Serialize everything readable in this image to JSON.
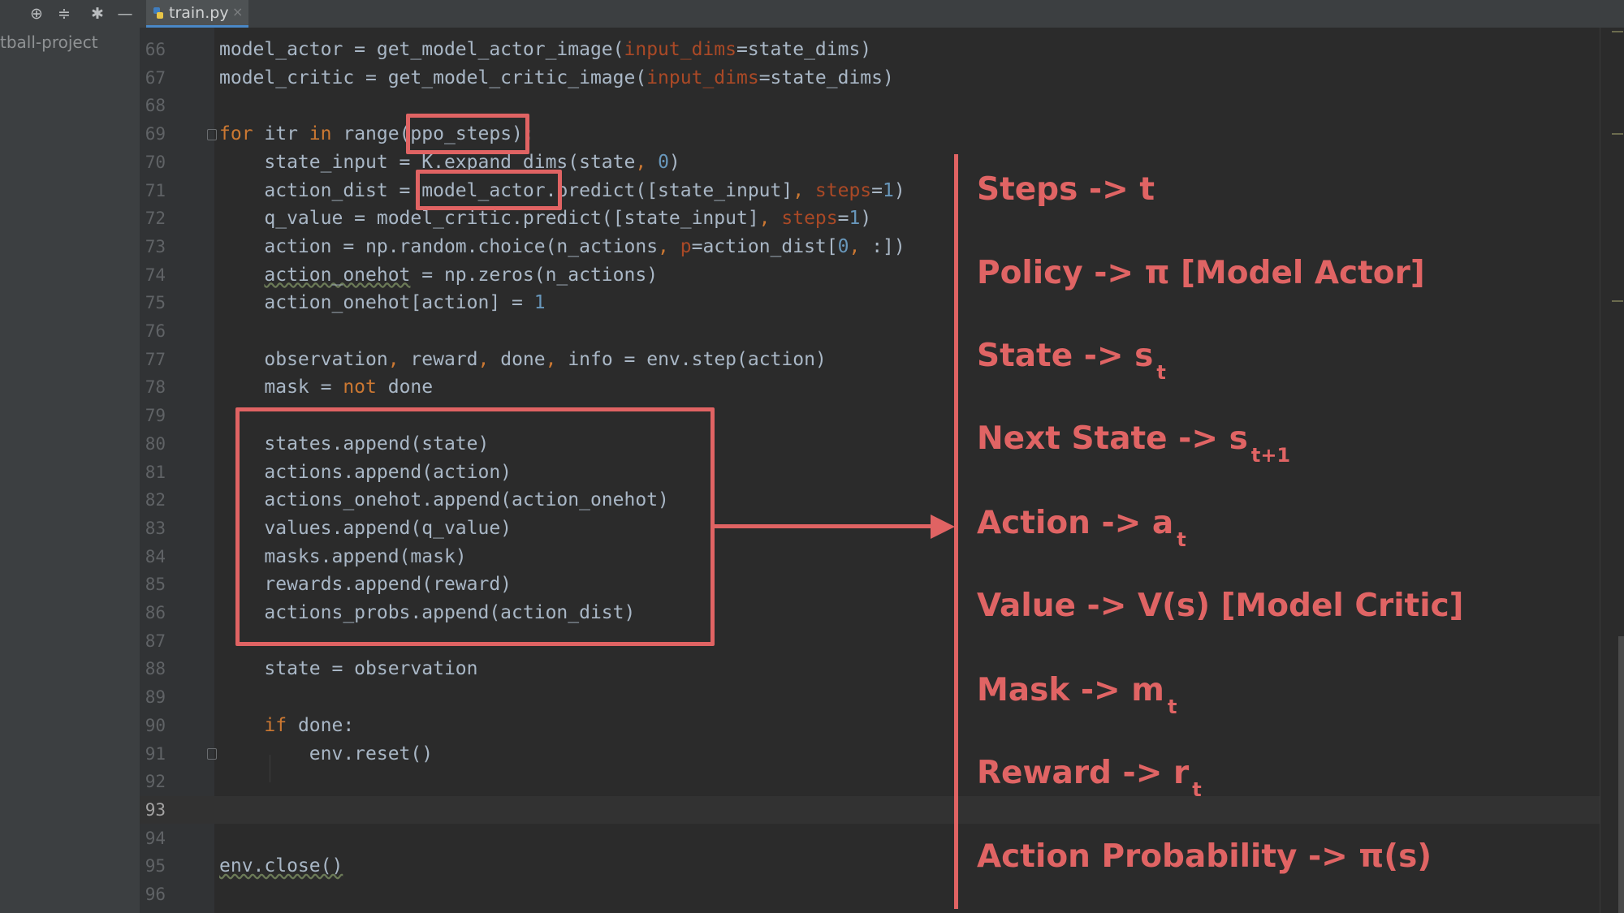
{
  "tab": {
    "filename": "train.py",
    "close": "×"
  },
  "project": {
    "label": "tball-project"
  },
  "toolbar": {
    "target": "⊕",
    "collapse": "≑",
    "settings": "✱",
    "hide": "—"
  },
  "lines": [
    {
      "n": "66",
      "segs": [
        [
          "model_actor = get_model_actor_image(",
          ""
        ],
        [
          "input_dims",
          "prm"
        ],
        [
          "=state_dims)",
          ""
        ]
      ]
    },
    {
      "n": "67",
      "segs": [
        [
          "model_critic = get_model_critic_image(",
          ""
        ],
        [
          "input_dims",
          "prm"
        ],
        [
          "=state_dims)",
          ""
        ]
      ]
    },
    {
      "n": "68",
      "segs": []
    },
    {
      "n": "69",
      "segs": [
        [
          "for",
          "kw"
        ],
        [
          " itr ",
          ""
        ],
        [
          "in",
          "kw"
        ],
        [
          " range(ppo_steps):",
          ""
        ]
      ]
    },
    {
      "n": "70",
      "segs": [
        [
          "    state_input = K.expand_dims(state",
          ""
        ],
        [
          ", ",
          "cm"
        ],
        [
          "0",
          "num"
        ],
        [
          ")",
          ""
        ]
      ]
    },
    {
      "n": "71",
      "segs": [
        [
          "    action_dist = model_actor.predict([state_input]",
          ""
        ],
        [
          ", ",
          "cm"
        ],
        [
          "steps",
          "prm"
        ],
        [
          "=",
          ""
        ],
        [
          "1",
          "num"
        ],
        [
          ")",
          ""
        ]
      ]
    },
    {
      "n": "72",
      "segs": [
        [
          "    q_value = model_critic.predict([state_input]",
          ""
        ],
        [
          ", ",
          "cm"
        ],
        [
          "steps",
          "prm"
        ],
        [
          "=",
          ""
        ],
        [
          "1",
          "num"
        ],
        [
          ")",
          ""
        ]
      ]
    },
    {
      "n": "73",
      "segs": [
        [
          "    action = np.random.choice(n_actions",
          ""
        ],
        [
          ", ",
          "cm"
        ],
        [
          "p",
          "prm"
        ],
        [
          "=action_dist[",
          ""
        ],
        [
          "0",
          "num"
        ],
        [
          ", ",
          "cm"
        ],
        [
          ":])",
          ""
        ]
      ]
    },
    {
      "n": "74",
      "segs": [
        [
          "    ",
          ""
        ],
        [
          "action_onehot",
          "wv"
        ],
        [
          " = np.zeros(n_actions)",
          ""
        ]
      ]
    },
    {
      "n": "75",
      "segs": [
        [
          "    action_onehot[action] = ",
          ""
        ],
        [
          "1",
          "num"
        ]
      ]
    },
    {
      "n": "76",
      "segs": []
    },
    {
      "n": "77",
      "segs": [
        [
          "    observation",
          ""
        ],
        [
          ", ",
          "cm"
        ],
        [
          "reward",
          ""
        ],
        [
          ", ",
          "cm"
        ],
        [
          "done",
          ""
        ],
        [
          ", ",
          "cm"
        ],
        [
          "info = env.step(action)",
          ""
        ]
      ]
    },
    {
      "n": "78",
      "segs": [
        [
          "    mask = ",
          ""
        ],
        [
          "not",
          "kw"
        ],
        [
          " done",
          ""
        ]
      ]
    },
    {
      "n": "79",
      "segs": []
    },
    {
      "n": "80",
      "segs": [
        [
          "    states.append(state)",
          ""
        ]
      ]
    },
    {
      "n": "81",
      "segs": [
        [
          "    actions.append(action)",
          ""
        ]
      ]
    },
    {
      "n": "82",
      "segs": [
        [
          "    actions_onehot.append(action_onehot)",
          ""
        ]
      ]
    },
    {
      "n": "83",
      "segs": [
        [
          "    values.append(q_value)",
          ""
        ]
      ]
    },
    {
      "n": "84",
      "segs": [
        [
          "    masks.append(mask)",
          ""
        ]
      ]
    },
    {
      "n": "85",
      "segs": [
        [
          "    rewards.append(reward)",
          ""
        ]
      ]
    },
    {
      "n": "86",
      "segs": [
        [
          "    actions_probs.append(action_dist)",
          ""
        ]
      ]
    },
    {
      "n": "87",
      "segs": []
    },
    {
      "n": "88",
      "segs": [
        [
          "    state = observation",
          ""
        ]
      ]
    },
    {
      "n": "89",
      "segs": []
    },
    {
      "n": "90",
      "segs": [
        [
          "    ",
          ""
        ],
        [
          "if",
          "kw"
        ],
        [
          " done:",
          ""
        ]
      ]
    },
    {
      "n": "91",
      "segs": [
        [
          "        env.reset()",
          ""
        ]
      ]
    },
    {
      "n": "92",
      "segs": []
    },
    {
      "n": "93",
      "segs": []
    },
    {
      "n": "94",
      "segs": []
    },
    {
      "n": "95",
      "segs": [
        [
          "env.close()",
          "wv"
        ]
      ]
    },
    {
      "n": "96",
      "segs": []
    }
  ],
  "annotations": [
    {
      "text": "Steps  ->  t",
      "sub": ""
    },
    {
      "text": "Policy  ->  π  [Model Actor]",
      "sub": ""
    },
    {
      "text": "State  ->  s",
      "sub": "t"
    },
    {
      "text": "Next State  ->  s",
      "sub": "t+1"
    },
    {
      "text": "Action  ->  a",
      "sub": "t"
    },
    {
      "text": "Value  ->  V(s)    [Model Critic]",
      "sub": ""
    },
    {
      "text": "Mask  ->  m",
      "sub": "t"
    },
    {
      "text": "Reward  ->  r",
      "sub": "t"
    },
    {
      "text": "Action Probability  ->  π(s)",
      "sub": ""
    }
  ],
  "colors": {
    "highlight": "#e06363",
    "keyword": "#cc7832",
    "number": "#6897bb",
    "param": "#aa4926",
    "text": "#a9b7c6"
  }
}
